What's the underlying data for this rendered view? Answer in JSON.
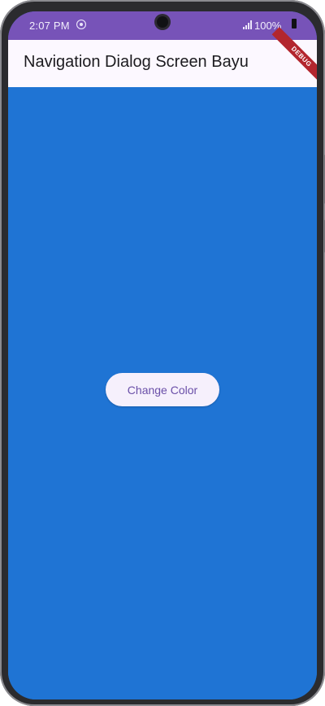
{
  "status_bar": {
    "time": "2:07 PM",
    "battery": "100%",
    "notification_icon": "circle-notification-icon",
    "signal_icon": "signal-icon",
    "battery_icon": "battery-icon"
  },
  "app_bar": {
    "title": "Navigation Dialog Screen Bayu",
    "debug_banner": "DEBUG"
  },
  "main": {
    "button_label": "Change Color",
    "background_color": "#1f74d4"
  },
  "colors": {
    "status_bar": "#7753b8",
    "app_bar": "#fcf8ff",
    "button_bg": "#f6f0fc",
    "button_text": "#6a4fa8",
    "debug_banner": "#b3262e"
  }
}
